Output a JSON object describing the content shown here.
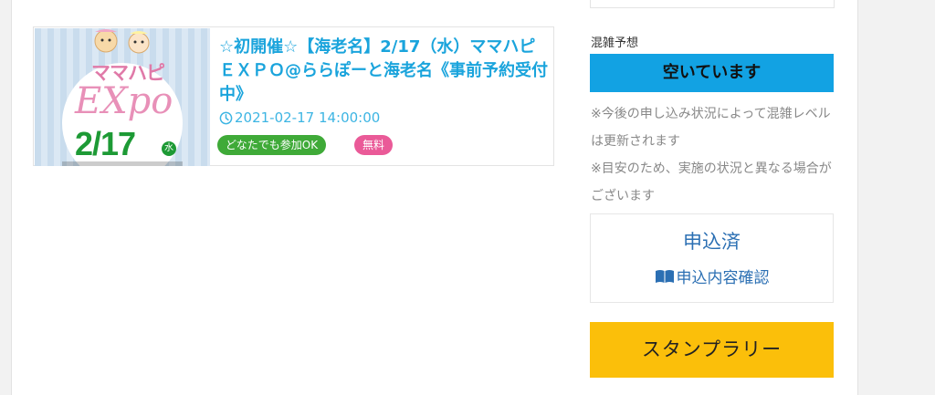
{
  "event": {
    "title": "☆初開催☆【海老名】2/17（水）ママハピＥＸＰＯ@ららぽーと海老名《事前予約受付中》",
    "datetime": "2021-02-17 14:00:00",
    "tags": [
      "どなたでも参加OK",
      "無料"
    ],
    "thumbnail": {
      "logo_text": "ママハピ",
      "expo_text": "EXpo",
      "date_text": "2/17",
      "weekday_text": "水"
    }
  },
  "sidebar": {
    "congestion_label": "混雑予想",
    "congestion_status": "空いています",
    "notes": [
      "※今後の申し込み状況によって混雑レベル は更新されます",
      "※目安のため、実施の状況と異なる場合がございます"
    ],
    "applied_status": "申込済",
    "applied_link": "申込内容確認",
    "stamp_rally": "スタンプラリー"
  },
  "colors": {
    "title_blue": "#1aa4dc",
    "congestion_blue": "#12a2e3",
    "tag_green": "#3faa38",
    "tag_pink": "#ea5a98",
    "link_blue": "#2b6fb3",
    "stamp_yellow": "#fbbf0a"
  },
  "icons": [
    "clock-icon",
    "book-icon"
  ]
}
